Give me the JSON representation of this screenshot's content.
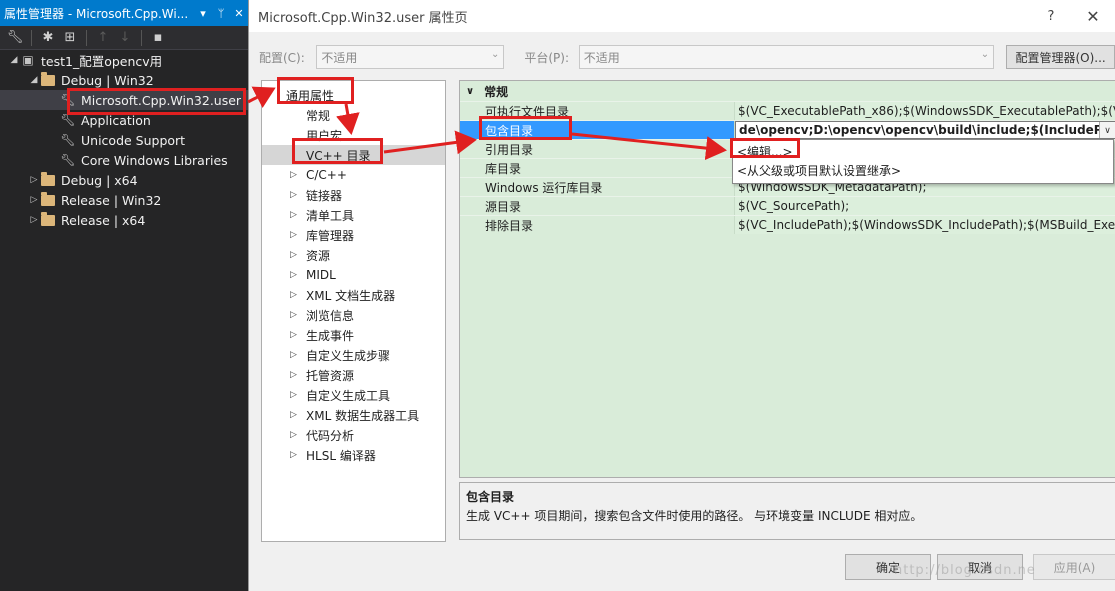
{
  "colors": {
    "accent": "#007acc",
    "annotation": "#e02020",
    "grid_bg": "#d9ecd9",
    "selection": "#3399ff"
  },
  "property_manager": {
    "title": "属性管理器 - Microsoft.Cpp.Wi...",
    "title_icons": [
      "chevron-down-icon",
      "pin-icon",
      "close-icon"
    ],
    "toolbar_icons": [
      "wrench-icon",
      "add-existing-sheet-icon",
      "add-new-sheet-icon",
      "move-up-icon",
      "move-down-icon",
      "save-icon"
    ],
    "tree": [
      {
        "label": "test1_配置opencv用",
        "icon": "project-icon",
        "expanded": true,
        "level": 0
      },
      {
        "label": "Debug | Win32",
        "icon": "folder-icon",
        "expanded": true,
        "level": 1
      },
      {
        "label": "Microsoft.Cpp.Win32.user",
        "icon": "wrench-icon",
        "level": 2,
        "selected": true
      },
      {
        "label": "Application",
        "icon": "wrench-icon",
        "level": 2
      },
      {
        "label": "Unicode Support",
        "icon": "wrench-icon",
        "level": 2
      },
      {
        "label": "Core Windows Libraries",
        "icon": "wrench-icon",
        "level": 2
      },
      {
        "label": "Debug | x64",
        "icon": "folder-icon",
        "expanded": false,
        "level": 1
      },
      {
        "label": "Release | Win32",
        "icon": "folder-icon",
        "expanded": false,
        "level": 1
      },
      {
        "label": "Release | x64",
        "icon": "folder-icon",
        "expanded": false,
        "level": 1
      }
    ]
  },
  "dialog": {
    "title": "Microsoft.Cpp.Win32.user 属性页",
    "help": "?",
    "close": "✕",
    "config_label": "配置(C):",
    "config_value": "不适用",
    "platform_label": "平台(P):",
    "platform_value": "不适用",
    "config_manager": "配置管理器(O)...",
    "nav": [
      {
        "label": "通用属性",
        "top": true,
        "expanded": true
      },
      {
        "label": "常规"
      },
      {
        "label": "用户宏"
      },
      {
        "label": "VC++ 目录",
        "selected": true
      },
      {
        "label": "C/C++",
        "arrow": true
      },
      {
        "label": "链接器",
        "arrow": true
      },
      {
        "label": "清单工具",
        "arrow": true
      },
      {
        "label": "库管理器",
        "arrow": true
      },
      {
        "label": "资源",
        "arrow": true
      },
      {
        "label": "MIDL",
        "arrow": true
      },
      {
        "label": "XML 文档生成器",
        "arrow": true
      },
      {
        "label": "浏览信息",
        "arrow": true
      },
      {
        "label": "生成事件",
        "arrow": true
      },
      {
        "label": "自定义生成步骤",
        "arrow": true
      },
      {
        "label": "托管资源",
        "arrow": true
      },
      {
        "label": "自定义生成工具",
        "arrow": true
      },
      {
        "label": "XML 数据生成器工具",
        "arrow": true
      },
      {
        "label": "代码分析",
        "arrow": true
      },
      {
        "label": "HLSL 编译器",
        "arrow": true
      }
    ],
    "grid": {
      "category": "常规",
      "rows": [
        {
          "name": "可执行文件目录",
          "value": "$(VC_ExecutablePath_x86);$(WindowsSDK_ExecutablePath);$(VS_E"
        },
        {
          "name": "包含目录",
          "value": "de\\opencv;D:\\opencv\\opencv\\build\\include;$(IncludePath)",
          "selected": true
        },
        {
          "name": "引用目录",
          "value": ""
        },
        {
          "name": "库目录",
          "value": ""
        },
        {
          "name": "Windows 运行库目录",
          "value": "$(WindowsSDK_MetadataPath);"
        },
        {
          "name": "源目录",
          "value": "$(VC_SourcePath);"
        },
        {
          "name": "排除目录",
          "value": "$(VC_IncludePath);$(WindowsSDK_IncludePath);$(MSBuild_Executa"
        }
      ]
    },
    "dropdown": [
      "<编辑...>",
      "<从父级或项目默认设置继承>"
    ],
    "description": {
      "title": "包含目录",
      "text": "生成 VC++ 项目期间，搜索包含文件时使用的路径。 与环境变量 INCLUDE 相对应。"
    },
    "buttons": {
      "ok": "确定",
      "cancel": "取消",
      "apply": "应用(A)"
    },
    "watermark": "http://blog.csdn.ne"
  }
}
